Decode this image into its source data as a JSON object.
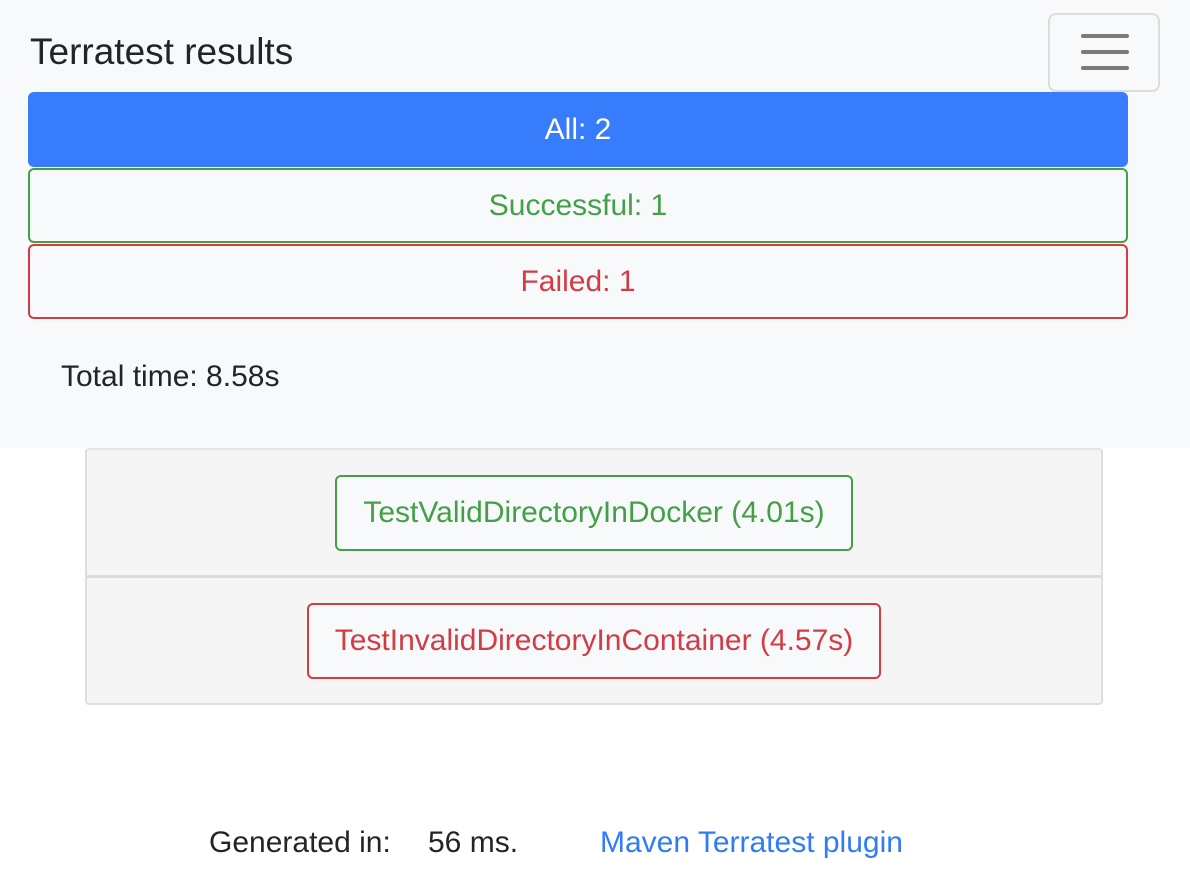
{
  "header": {
    "title": "Terratest results",
    "menu_icon": "hamburger-menu-icon"
  },
  "filters": {
    "all": "All: 2",
    "successful": "Successful: 1",
    "failed": "Failed: 1"
  },
  "summary": {
    "total_time": "Total time: 8.58s"
  },
  "tests": [
    {
      "label": "TestValidDirectoryInDocker (4.01s)",
      "status": "success"
    },
    {
      "label": "TestInvalidDirectoryInContainer (4.57s)",
      "status": "failed"
    }
  ],
  "footer": {
    "generated_label": "Generated in:",
    "generated_value": "56 ms.",
    "plugin_link": "Maven Terratest plugin"
  },
  "colors": {
    "primary": "#377cfb",
    "success": "#43a047",
    "danger": "#d13c45",
    "link": "#2f7cf6",
    "navbar_bg": "#f8f9fa"
  }
}
